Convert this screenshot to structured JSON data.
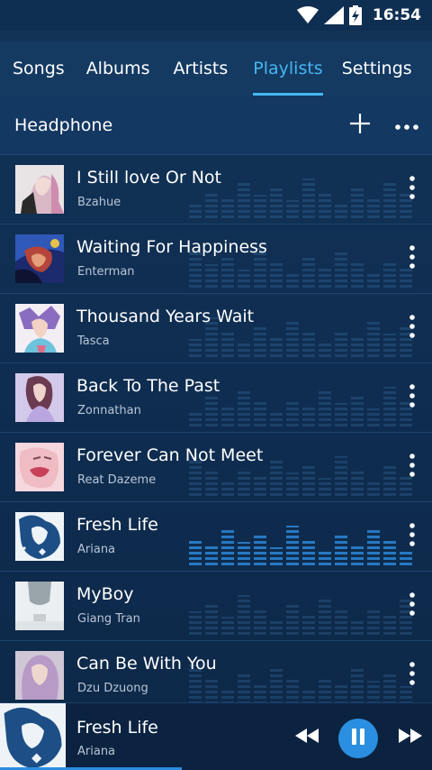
{
  "status_bar": {
    "time": "16:54",
    "icons": [
      "wifi-icon",
      "signal-icon",
      "battery-charging-icon"
    ]
  },
  "tabs": [
    {
      "label": "Songs",
      "active": false
    },
    {
      "label": "Albums",
      "active": false
    },
    {
      "label": "Artists",
      "active": false
    },
    {
      "label": "Playlists",
      "active": true
    },
    {
      "label": "Settings",
      "active": false
    }
  ],
  "playlist": {
    "title": "Headphone",
    "add_icon": "plus-icon",
    "more_icon": "more-horizontal-icon"
  },
  "songs": [
    {
      "title": "I Still love Or Not",
      "artist": "Bzahue",
      "playing": false
    },
    {
      "title": "Waiting For Happiness",
      "artist": "Enterman",
      "playing": false
    },
    {
      "title": "Thousand Years Wait",
      "artist": "Tasca",
      "playing": false
    },
    {
      "title": "Back To The Past",
      "artist": "Zonnathan",
      "playing": false
    },
    {
      "title": "Forever Can Not Meet",
      "artist": "Reat Dazeme",
      "playing": false
    },
    {
      "title": "Fresh Life",
      "artist": "Ariana",
      "playing": true
    },
    {
      "title": "MyBoy",
      "artist": "Giang Tran",
      "playing": false
    },
    {
      "title": "Can Be With You",
      "artist": "Dzu Dzuong",
      "playing": false
    }
  ],
  "now_playing": {
    "title": "Fresh Life",
    "artist": "Ariana",
    "state": "playing",
    "progress": 0.42,
    "controls": [
      "rewind-icon",
      "pause-icon",
      "fast-forward-icon"
    ]
  },
  "colors": {
    "accent": "#46b6f0",
    "play_button": "#2a8fe0",
    "background": "#0f2e52"
  }
}
